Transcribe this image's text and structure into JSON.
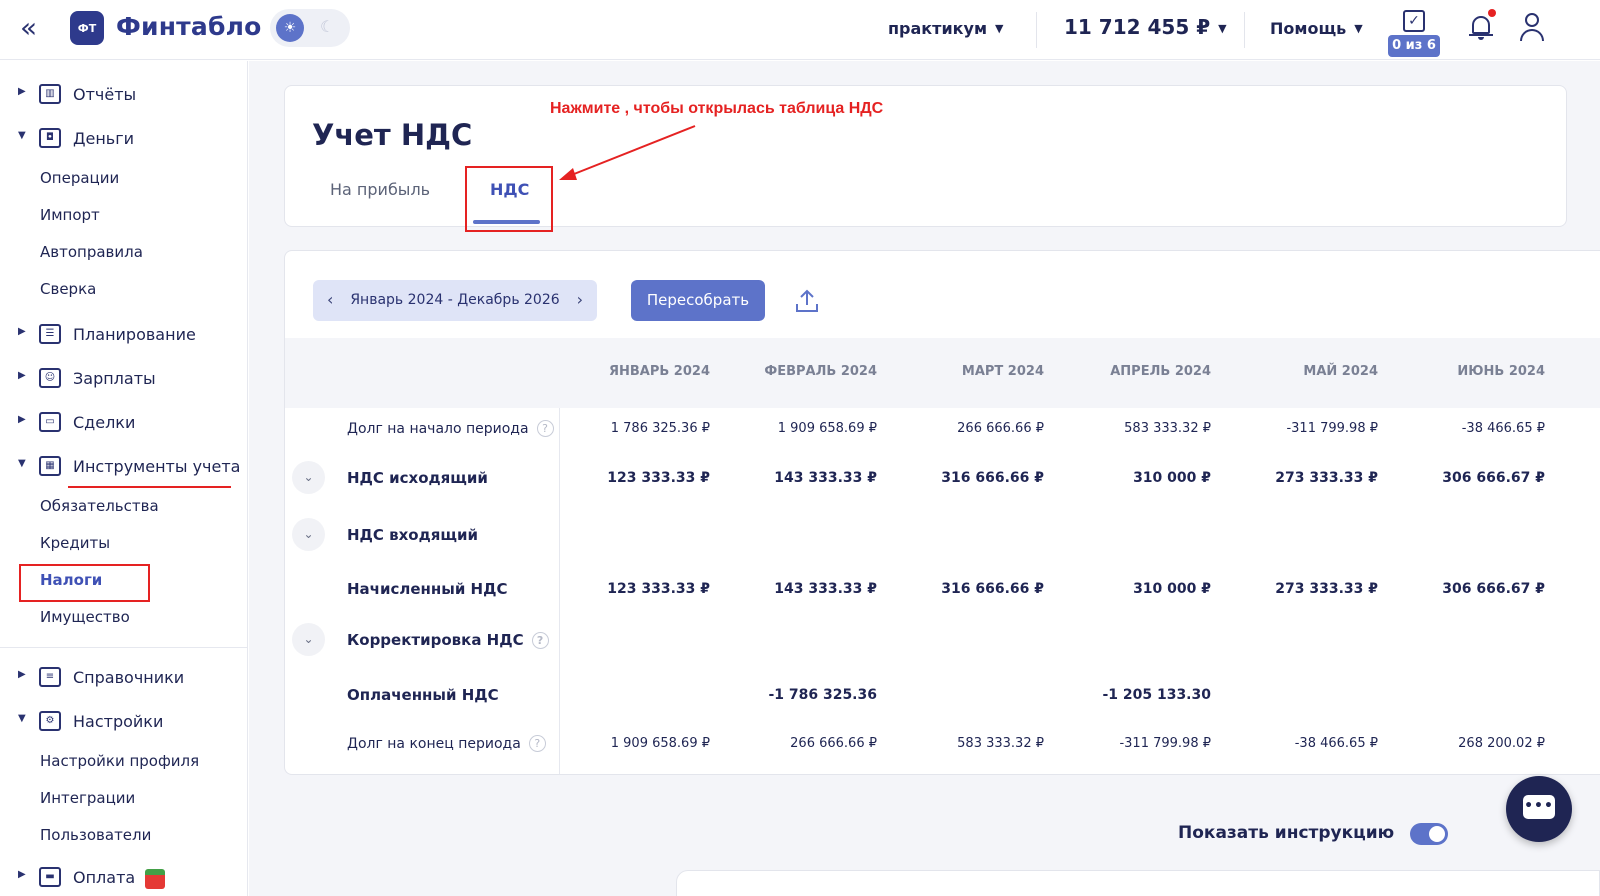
{
  "app": {
    "logo_badge": "ФТ",
    "name": "Финтабло"
  },
  "topbar": {
    "org_name": "практикум",
    "balance": "11 712 455 ₽",
    "help_label": "Помощь",
    "tasks_badge": "0 из 6"
  },
  "sidebar": {
    "groups": [
      {
        "label": "Отчёты"
      },
      {
        "label": "Деньги"
      },
      {
        "label": "Планирование"
      },
      {
        "label": "Зарплаты"
      },
      {
        "label": "Сделки"
      },
      {
        "label": "Инструменты учета"
      },
      {
        "label": "Справочники"
      },
      {
        "label": "Настройки"
      },
      {
        "label": "Оплата"
      }
    ],
    "money_items": [
      "Операции",
      "Импорт",
      "Автоправила",
      "Сверка"
    ],
    "tools_items": [
      "Обязательства",
      "Кредиты",
      "Налоги",
      "Имущество"
    ],
    "settings_items": [
      "Настройки профиля",
      "Интеграции",
      "Пользователи"
    ],
    "active_item": "Налоги"
  },
  "page": {
    "title": "Учет НДС",
    "tabs": [
      {
        "label": "На прибыль",
        "active": false
      },
      {
        "label": "НДС",
        "active": true
      }
    ],
    "annotation": "Нажмите , чтобы открылась таблица НДС"
  },
  "toolbar": {
    "period": "Январь 2024 - Декабрь 2026",
    "rebuild_label": "Пересобрать"
  },
  "table": {
    "columns": [
      "ЯНВАРЬ 2024",
      "ФЕВРАЛЬ 2024",
      "МАРТ 2024",
      "АПРЕЛЬ 2024",
      "МАЙ 2024",
      "ИЮНЬ 2024"
    ],
    "rows": [
      {
        "label": "Долг на начало периода",
        "help": true,
        "expandable": false,
        "bold": false,
        "values": [
          "1 786 325.36 ₽",
          "1 909 658.69 ₽",
          "266 666.66 ₽",
          "583 333.32 ₽",
          "-311 799.98 ₽",
          "-38 466.65 ₽"
        ]
      },
      {
        "label": "НДС исходящий",
        "help": false,
        "expandable": true,
        "bold": true,
        "values": [
          "123 333.33 ₽",
          "143 333.33 ₽",
          "316 666.66 ₽",
          "310 000 ₽",
          "273 333.33 ₽",
          "306 666.67 ₽"
        ]
      },
      {
        "label": "НДС входящий",
        "help": false,
        "expandable": true,
        "bold": true,
        "values": [
          "",
          "",
          "",
          "",
          "",
          ""
        ]
      },
      {
        "label": "Начисленный НДС",
        "help": false,
        "expandable": false,
        "bold": true,
        "values": [
          "123 333.33 ₽",
          "143 333.33 ₽",
          "316 666.66 ₽",
          "310 000 ₽",
          "273 333.33 ₽",
          "306 666.67 ₽"
        ]
      },
      {
        "label": "Корректировка НДС",
        "help": true,
        "expandable": true,
        "bold": true,
        "values": [
          "",
          "",
          "",
          "",
          "",
          ""
        ]
      },
      {
        "label": "Оплаченный НДС",
        "help": false,
        "expandable": false,
        "bold": true,
        "values": [
          "",
          "-1 786 325.36",
          "",
          "-1 205 133.30",
          "",
          ""
        ]
      },
      {
        "label": "Долг на конец периода",
        "help": true,
        "expandable": false,
        "bold": false,
        "values": [
          "1 909 658.69 ₽",
          "266 666.66 ₽",
          "583 333.32 ₽",
          "-311 799.98 ₽",
          "-38 466.65 ₽",
          "268 200.02 ₽"
        ]
      }
    ]
  },
  "footer": {
    "instruction_label": "Показать инструкцию",
    "instruction_on": true
  },
  "colors": {
    "accent": "#5d73c9",
    "brand": "#2e3a8c",
    "annotation": "#e52222",
    "text": "#1f2553"
  }
}
